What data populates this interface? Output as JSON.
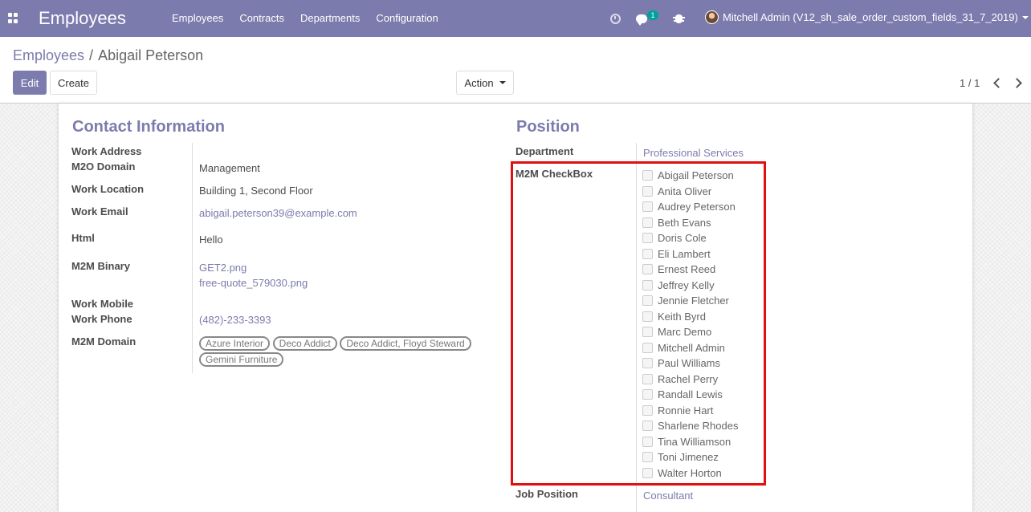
{
  "navbar": {
    "brand": "Employees",
    "menu": [
      "Employees",
      "Contracts",
      "Departments",
      "Configuration"
    ],
    "chat_count": "1",
    "user": "Mitchell Admin (V12_sh_sale_order_custom_fields_31_7_2019)",
    "icons": [
      "apps-icon",
      "clock-icon",
      "chat-icon",
      "bug-icon"
    ],
    "accent": "#7c7bad"
  },
  "breadcrumb": {
    "parent": "Employees",
    "separator": "/",
    "current": "Abigail Peterson"
  },
  "buttons": {
    "edit": "Edit",
    "create": "Create",
    "action": "Action"
  },
  "pager": {
    "value": "1 / 1"
  },
  "contact": {
    "title": "Contact Information",
    "work_address_label": "Work Address",
    "m2o_domain_label": "M2O Domain",
    "m2o_domain_value": "Management",
    "work_location_label": "Work Location",
    "work_location_value": "Building 1, Second Floor",
    "work_email_label": "Work Email",
    "work_email_value": "abigail.peterson39@example.com",
    "html_label": "Html",
    "html_value": "Hello",
    "m2m_binary_label": "M2M Binary",
    "m2m_binary_files": [
      "GET2.png",
      "free-quote_579030.png"
    ],
    "work_mobile_label": "Work Mobile",
    "work_phone_label": "Work Phone",
    "work_phone_value": "(482)-233-3393",
    "m2m_domain_label": "M2M Domain",
    "m2m_domain_tags": [
      "Azure Interior",
      "Deco Addict",
      "Deco Addict, Floyd Steward",
      "Gemini Furniture"
    ]
  },
  "position": {
    "title": "Position",
    "department_label": "Department",
    "department_value": "Professional Services",
    "m2m_checkbox_label": "M2M CheckBox",
    "m2m_checkbox_items": [
      {
        "name": "Abigail Peterson",
        "checked": false
      },
      {
        "name": "Anita Oliver",
        "checked": false
      },
      {
        "name": "Audrey Peterson",
        "checked": false
      },
      {
        "name": "Beth Evans",
        "checked": false
      },
      {
        "name": "Doris Cole",
        "checked": false
      },
      {
        "name": "Eli Lambert",
        "checked": false
      },
      {
        "name": "Ernest Reed",
        "checked": false
      },
      {
        "name": "Jeffrey Kelly",
        "checked": false
      },
      {
        "name": "Jennie Fletcher",
        "checked": false
      },
      {
        "name": "Keith Byrd",
        "checked": false
      },
      {
        "name": "Marc Demo",
        "checked": false
      },
      {
        "name": "Mitchell Admin",
        "checked": false
      },
      {
        "name": "Paul Williams",
        "checked": false
      },
      {
        "name": "Rachel Perry",
        "checked": false
      },
      {
        "name": "Randall Lewis",
        "checked": false
      },
      {
        "name": "Ronnie Hart",
        "checked": false
      },
      {
        "name": "Sharlene Rhodes",
        "checked": false
      },
      {
        "name": "Tina Williamson",
        "checked": false
      },
      {
        "name": "Toni Jimenez",
        "checked": false
      },
      {
        "name": "Walter Horton",
        "checked": false
      }
    ],
    "job_position_label": "Job Position",
    "job_position_value": "Consultant",
    "highlight_color": "#e01010"
  }
}
